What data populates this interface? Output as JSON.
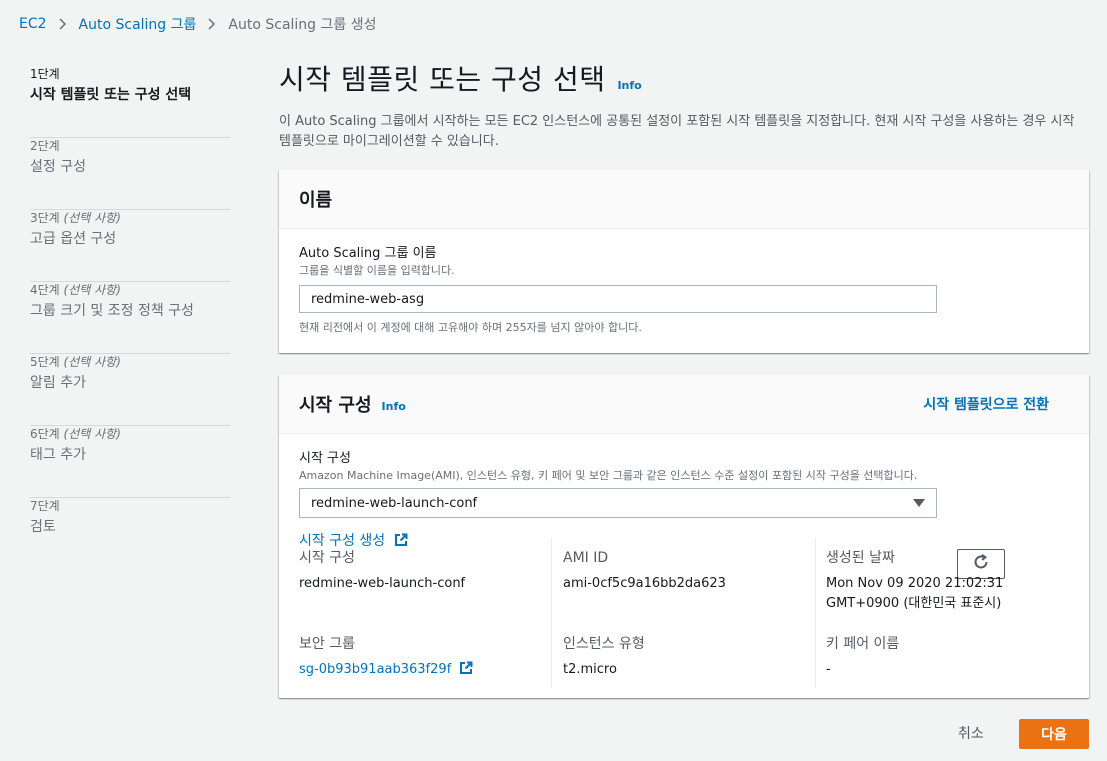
{
  "breadcrumb": {
    "items": [
      "EC2",
      "Auto Scaling 그룹",
      "Auto Scaling 그룹 생성"
    ]
  },
  "steps": [
    {
      "num": "1단계",
      "optional": "",
      "title": "시작 템플릿 또는 구성 선택"
    },
    {
      "num": "2단계",
      "optional": "",
      "title": "설정 구성"
    },
    {
      "num": "3단계",
      "optional": "(선택 사항)",
      "title": "고급 옵션 구성"
    },
    {
      "num": "4단계",
      "optional": "(선택 사항)",
      "title": "그룹 크기 및 조정 정책 구성"
    },
    {
      "num": "5단계",
      "optional": "(선택 사항)",
      "title": "알림 추가"
    },
    {
      "num": "6단계",
      "optional": "(선택 사항)",
      "title": "태그 추가"
    },
    {
      "num": "7단계",
      "optional": "",
      "title": "검토"
    }
  ],
  "page": {
    "title": "시작 템플릿 또는 구성 선택",
    "info": "Info",
    "description": "이 Auto Scaling 그룹에서 시작하는 모든 EC2 인스턴스에 공통된 설정이 포함된 시작 템플릿을 지정합니다. 현재 시작 구성을 사용하는 경우 시작 템플릿으로 마이그레이션할 수 있습니다."
  },
  "name_panel": {
    "header": "이름",
    "label": "Auto Scaling 그룹 이름",
    "hint": "그룹을 식별할 이름을 입력합니다.",
    "value": "redmine-web-asg",
    "constraint": "현재 리전에서 이 계정에 대해 고유해야 하며 255자를 넘지 않아야 합니다."
  },
  "config_panel": {
    "header": "시작 구성",
    "info": "Info",
    "switch_link": "시작 템플릿으로 전환",
    "label": "시작 구성",
    "hint": "Amazon Machine Image(AMI), 인스턴스 유형, 키 페어 및 보안 그룹과 같은 인스턴스 수준 설정이 포함된 시작 구성을 선택합니다.",
    "selected": "redmine-web-launch-conf",
    "create_link": "시작 구성 생성",
    "details": {
      "launch_config_label": "시작 구성",
      "launch_config_value": "redmine-web-launch-conf",
      "ami_label": "AMI ID",
      "ami_value": "ami-0cf5c9a16bb2da623",
      "created_label": "생성된 날짜",
      "created_value_1": "Mon Nov 09 2020 21:02:31",
      "created_value_2": "GMT+0900 (대한민국 표준시)",
      "sg_label": "보안 그룹",
      "sg_value": "sg-0b93b91aab363f29f",
      "instance_type_label": "인스턴스 유형",
      "instance_type_value": "t2.micro",
      "keypair_label": "키 페어 이름",
      "keypair_value": "-"
    }
  },
  "footer": {
    "cancel": "취소",
    "next": "다음"
  },
  "colors": {
    "link": "#0073bb",
    "primary_button": "#ec7211",
    "background": "#f2f3f3"
  }
}
